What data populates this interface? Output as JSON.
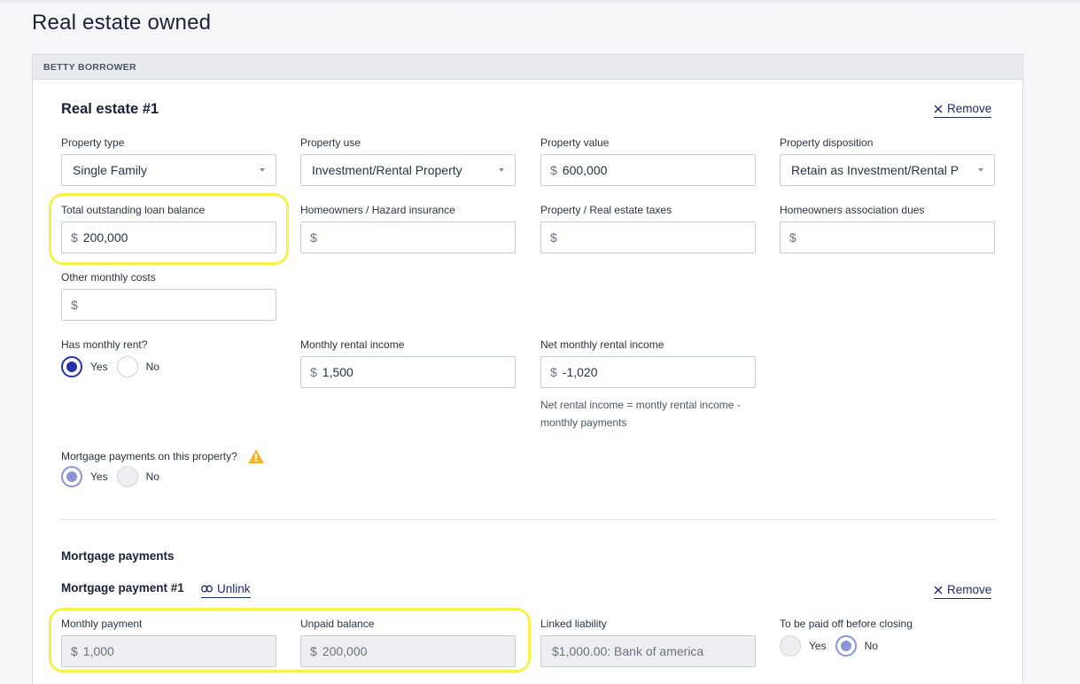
{
  "page_title": "Real estate owned",
  "borrower_header": "BETTY BORROWER",
  "real_estate": {
    "title": "Real estate #1",
    "remove_label": "Remove",
    "property_type": {
      "label": "Property type",
      "value": "Single Family"
    },
    "property_use": {
      "label": "Property use",
      "value": "Investment/Rental Property"
    },
    "property_value": {
      "label": "Property value",
      "currency": "$",
      "value": "600,000"
    },
    "property_disposition": {
      "label": "Property disposition",
      "value": "Retain as Investment/Rental P"
    },
    "loan_balance": {
      "label": "Total outstanding loan balance",
      "currency": "$",
      "value": "200,000"
    },
    "hazard_insurance": {
      "label": "Homeowners / Hazard insurance",
      "currency": "$",
      "value": ""
    },
    "taxes": {
      "label": "Property / Real estate taxes",
      "currency": "$",
      "value": ""
    },
    "hoa_dues": {
      "label": "Homeowners association dues",
      "currency": "$",
      "value": ""
    },
    "other_costs": {
      "label": "Other monthly costs",
      "currency": "$",
      "value": ""
    },
    "has_rent": {
      "label": "Has monthly rent?",
      "yes": "Yes",
      "no": "No",
      "selected": "Yes"
    },
    "monthly_rental_income": {
      "label": "Monthly rental income",
      "currency": "$",
      "value": "1,500"
    },
    "net_rental_income": {
      "label": "Net monthly rental income",
      "currency": "$",
      "value": "-1,020",
      "helper": "Net rental income = montly rental income - monthly payments"
    },
    "mortgage_payments_q": {
      "label": "Mortgage payments on this property?",
      "yes": "Yes",
      "no": "No",
      "selected": "Yes"
    }
  },
  "mortgage_section": {
    "title": "Mortgage payments",
    "payment": {
      "title": "Mortgage payment #1",
      "unlink_label": "Unlink",
      "remove_label": "Remove",
      "monthly_payment": {
        "label": "Monthly payment",
        "currency": "$",
        "value": "1,000"
      },
      "unpaid_balance": {
        "label": "Unpaid balance",
        "currency": "$",
        "value": "200,000"
      },
      "linked_liability": {
        "label": "Linked liability",
        "value": "$1,000.00: Bank of america"
      },
      "paid_off": {
        "label": "To be paid off before closing",
        "yes": "Yes",
        "no": "No",
        "selected": "No"
      }
    }
  },
  "colors": {
    "accent": "#2233a8",
    "highlight": "#f3f34a",
    "warning": "#f5b82e"
  }
}
